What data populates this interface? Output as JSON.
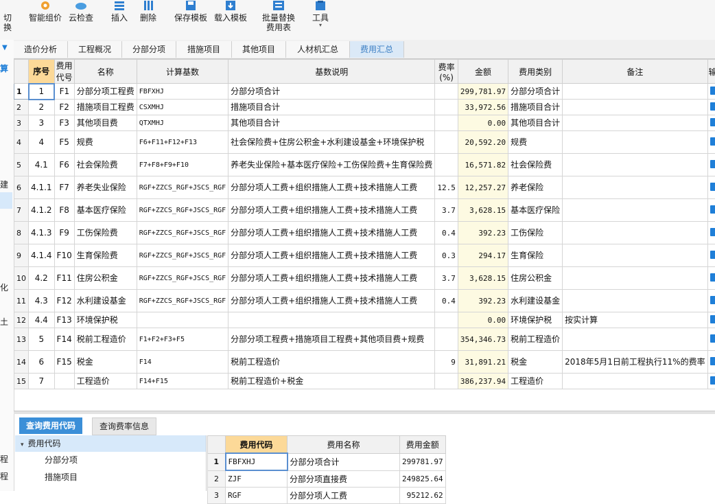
{
  "toolbar": {
    "items": [
      {
        "label": "切换",
        "icon": "switch-icon"
      },
      {
        "label": "智能组价",
        "icon": "smart-pricing-icon"
      },
      {
        "label": "云检查",
        "icon": "cloud-check-icon"
      },
      {
        "label": "插入",
        "icon": "insert-icon"
      },
      {
        "label": "删除",
        "icon": "delete-icon"
      },
      {
        "label": "保存模板",
        "icon": "save-template-icon"
      },
      {
        "label": "载入模板",
        "icon": "load-template-icon"
      },
      {
        "label": "批量替换\n费用表",
        "icon": "batch-replace-icon"
      },
      {
        "label": "工具",
        "icon": "tools-icon"
      }
    ]
  },
  "left_strip": {
    "chars": [
      "算",
      "建",
      "化",
      "土",
      "程",
      "程"
    ]
  },
  "tabs": [
    "造价分析",
    "工程概况",
    "分部分项",
    "措施项目",
    "其他项目",
    "人材机汇总",
    "费用汇总"
  ],
  "active_tab": "费用汇总",
  "table": {
    "headers": [
      "序号",
      "费用代号",
      "名称",
      "计算基数",
      "基数说明",
      "费率(%)",
      "金额",
      "费用类别",
      "备注",
      "输"
    ],
    "rows": [
      {
        "n": "1",
        "seq": "1",
        "code": "F1",
        "name": "分部分项工程费",
        "base": "FBFXHJ",
        "desc": "分部分项合计",
        "rate": "",
        "amt": "299,781.97",
        "cat": "分部分项合计",
        "note": ""
      },
      {
        "n": "2",
        "seq": "2",
        "code": "F2",
        "name": "措施项目工程费",
        "base": "CSXMHJ",
        "desc": "措施项目合计",
        "rate": "",
        "amt": "33,972.56",
        "cat": "措施项目合计",
        "note": ""
      },
      {
        "n": "3",
        "seq": "3",
        "code": "F3",
        "name": "其他项目费",
        "base": "QTXMHJ",
        "desc": "其他项目合计",
        "rate": "",
        "amt": "0.00",
        "cat": "其他项目合计",
        "note": ""
      },
      {
        "n": "4",
        "seq": "4",
        "code": "F5",
        "name": "规费",
        "base": "F6+F11+F12+F13",
        "desc": "社会保险费+住房公积金+水利建设基金+环境保护税",
        "rate": "",
        "amt": "20,592.20",
        "cat": "规费",
        "note": ""
      },
      {
        "n": "5",
        "seq": "4.1",
        "code": "F6",
        "name": "社会保险费",
        "base": "F7+F8+F9+F10",
        "desc": "养老失业保险+基本医疗保险+工伤保险费+生育保险费",
        "rate": "",
        "amt": "16,571.82",
        "cat": "社会保险费",
        "note": ""
      },
      {
        "n": "6",
        "seq": "4.1.1",
        "code": "F7",
        "name": "养老失业保险",
        "base": "RGF+ZZCS_RGF+JSCS_RGF",
        "desc": "分部分项人工费+组织措施人工费+技术措施人工费",
        "rate": "12.5",
        "amt": "12,257.27",
        "cat": "养老保险",
        "note": ""
      },
      {
        "n": "7",
        "seq": "4.1.2",
        "code": "F8",
        "name": "基本医疗保险",
        "base": "RGF+ZZCS_RGF+JSCS_RGF",
        "desc": "分部分项人工费+组织措施人工费+技术措施人工费",
        "rate": "3.7",
        "amt": "3,628.15",
        "cat": "基本医疗保险",
        "note": ""
      },
      {
        "n": "8",
        "seq": "4.1.3",
        "code": "F9",
        "name": "工伤保险费",
        "base": "RGF+ZZCS_RGF+JSCS_RGF",
        "desc": "分部分项人工费+组织措施人工费+技术措施人工费",
        "rate": "0.4",
        "amt": "392.23",
        "cat": "工伤保险",
        "note": ""
      },
      {
        "n": "9",
        "seq": "4.1.4",
        "code": "F10",
        "name": "生育保险费",
        "base": "RGF+ZZCS_RGF+JSCS_RGF",
        "desc": "分部分项人工费+组织措施人工费+技术措施人工费",
        "rate": "0.3",
        "amt": "294.17",
        "cat": "生育保险",
        "note": ""
      },
      {
        "n": "10",
        "seq": "4.2",
        "code": "F11",
        "name": "住房公积金",
        "base": "RGF+ZZCS_RGF+JSCS_RGF",
        "desc": "分部分项人工费+组织措施人工费+技术措施人工费",
        "rate": "3.7",
        "amt": "3,628.15",
        "cat": "住房公积金",
        "note": ""
      },
      {
        "n": "11",
        "seq": "4.3",
        "code": "F12",
        "name": "水利建设基金",
        "base": "RGF+ZZCS_RGF+JSCS_RGF",
        "desc": "分部分项人工费+组织措施人工费+技术措施人工费",
        "rate": "0.4",
        "amt": "392.23",
        "cat": "水利建设基金",
        "note": ""
      },
      {
        "n": "12",
        "seq": "4.4",
        "code": "F13",
        "name": "环境保护税",
        "base": "",
        "desc": "",
        "rate": "",
        "amt": "0.00",
        "cat": "环境保护税",
        "note": "按实计算"
      },
      {
        "n": "13",
        "seq": "5",
        "code": "F14",
        "name": "税前工程造价",
        "base": "F1+F2+F3+F5",
        "desc": "分部分项工程费+措施项目工程费+其他项目费+规费",
        "rate": "",
        "amt": "354,346.73",
        "cat": "税前工程造价",
        "note": ""
      },
      {
        "n": "14",
        "seq": "6",
        "code": "F15",
        "name": "税金",
        "base": "F14",
        "desc": "税前工程造价",
        "rate": "9",
        "amt": "31,891.21",
        "cat": "税金",
        "note": "2018年5月1日前工程执行11%的费率"
      },
      {
        "n": "15",
        "seq": "7",
        "code": "",
        "name": "工程造价",
        "base": "F14+F15",
        "desc": "税前工程造价+税金",
        "rate": "",
        "amt": "386,237.94",
        "cat": "工程造价",
        "note": ""
      }
    ]
  },
  "bottom_tabs": [
    "查询费用代码",
    "查询费率信息"
  ],
  "tree": {
    "root": "费用代码",
    "items": [
      "分部分项",
      "措施项目"
    ]
  },
  "code_table": {
    "headers": [
      "费用代码",
      "费用名称",
      "费用金额"
    ],
    "rows": [
      {
        "n": "1",
        "code": "FBFXHJ",
        "name": "分部分项合计",
        "amt": "299781.97"
      },
      {
        "n": "2",
        "code": "ZJF",
        "name": "分部分项直接费",
        "amt": "249825.64"
      },
      {
        "n": "3",
        "code": "RGF",
        "name": "分部分项人工费",
        "amt": "95212.62"
      }
    ]
  },
  "colors": {
    "accent": "#3b8fd8",
    "seq_header": "#fcd998",
    "amount_bg": "#fdfae2"
  }
}
